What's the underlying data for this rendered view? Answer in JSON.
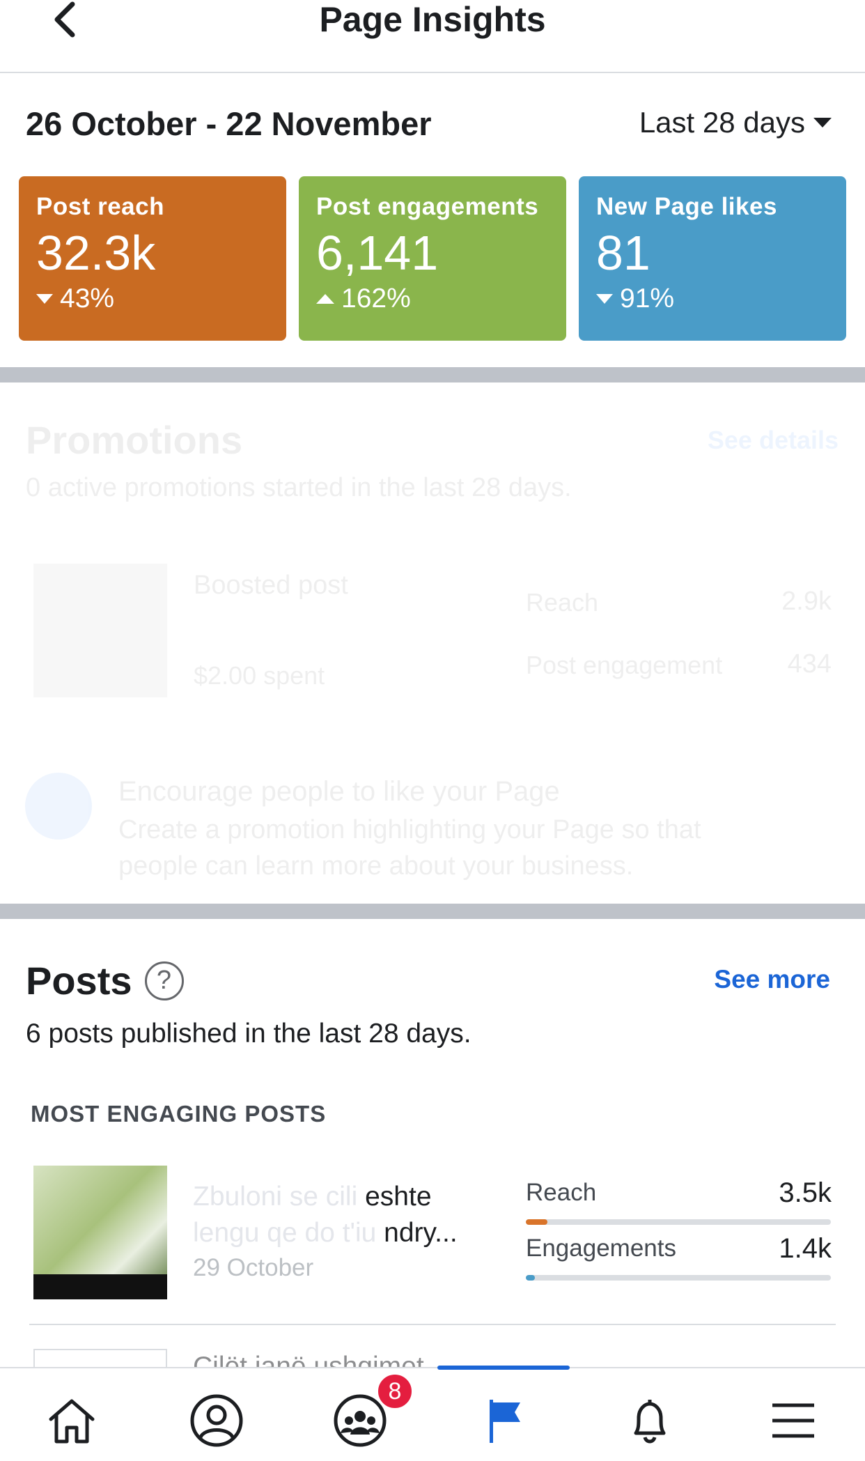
{
  "header": {
    "title": "Page Insights",
    "back_icon": "chevron-left-icon"
  },
  "overview": {
    "date_range": "26 October - 22 November",
    "period": "Last 28 days"
  },
  "cards": [
    {
      "label": "Post reach",
      "value": "32.3k",
      "change": "43%",
      "direction": "down",
      "color": "#c96b22"
    },
    {
      "label": "Post engagements",
      "value": "6,141",
      "change": "162%",
      "direction": "up",
      "color": "#8ab54c"
    },
    {
      "label": "New Page likes",
      "value": "81",
      "change": "91%",
      "direction": "down",
      "color": "#4a9cc8"
    }
  ],
  "promotions": {
    "title": "Promotions",
    "link": "See details",
    "subtitle": "0 active promotions started in the last 28 days.",
    "post_title": "Boosted post",
    "spent": "$2.00 spent",
    "metrics": [
      {
        "label": "Reach",
        "value": "2.9k"
      },
      {
        "label": "Post engagement",
        "value": "434"
      }
    ],
    "cta_title": "Encourage people to like your Page",
    "cta_text": "Create a promotion highlighting your Page so that people can learn more about your business."
  },
  "posts": {
    "title": "Posts",
    "see_more": "See more",
    "subtitle": "6 posts published in the last 28 days.",
    "section_label": "MOST ENGAGING POSTS",
    "items": [
      {
        "text_faded": "Zbuloni se cili ",
        "text_visible": "eshte",
        "text_line2_faded": "lengu qe do t'iu ",
        "text_line2_visible": "ndry...",
        "date": "29 October",
        "reach_label": "Reach",
        "reach_value": "3.5k",
        "reach_fill": 0.07,
        "reach_color": "#d9742a",
        "eng_label": "Engagements",
        "eng_value": "1.4k",
        "eng_fill": 0.03,
        "eng_color": "#4a9cc8"
      }
    ],
    "next_item_text": "Cilët janë ushqimet"
  },
  "tabbar": {
    "badge_count": "8",
    "tabs": [
      "home-icon",
      "profile-icon",
      "groups-icon",
      "flag-icon",
      "bell-icon",
      "menu-icon"
    ]
  }
}
